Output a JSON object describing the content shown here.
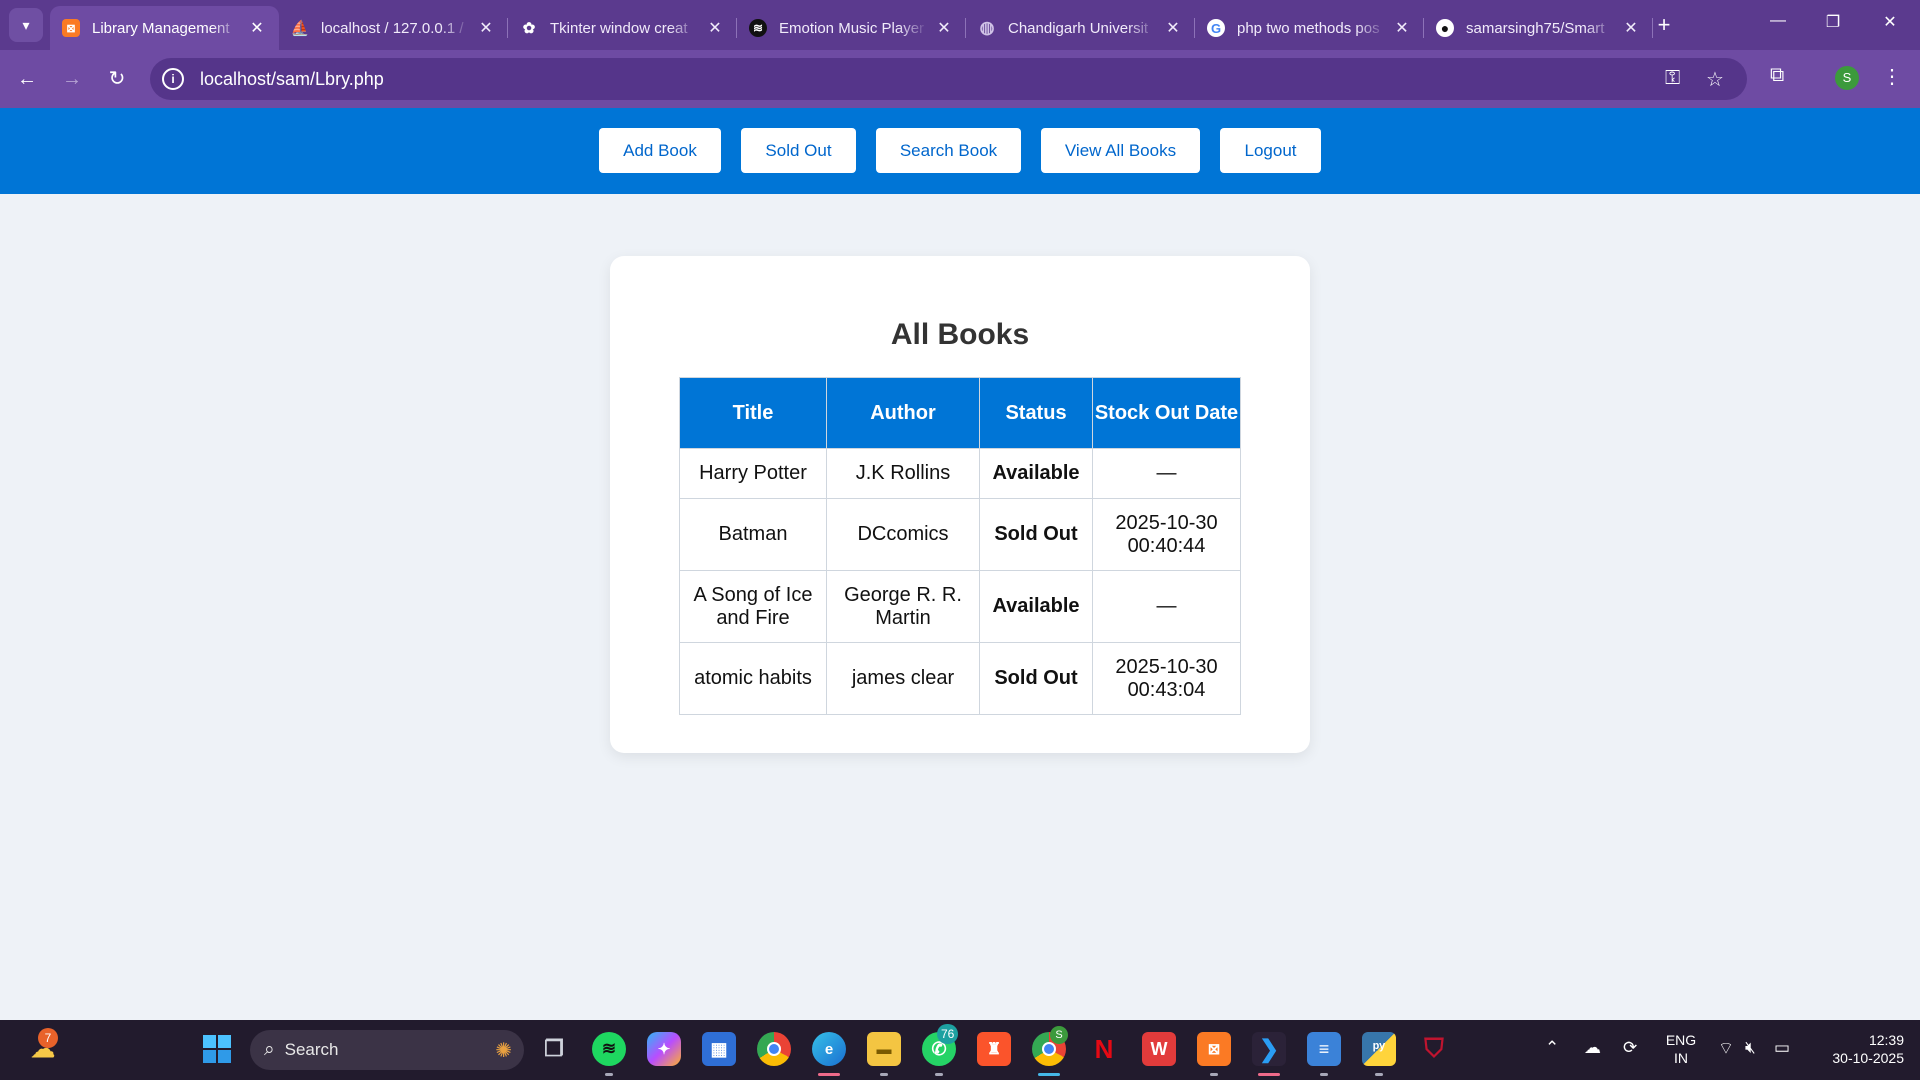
{
  "browser": {
    "tabs": [
      {
        "title": "Library Management",
        "icon": "xampp-icon",
        "color": "#fb7a24",
        "glyph": "⊠"
      },
      {
        "title": "localhost / 127.0.0.1 / ",
        "icon": "phpmyadmin-icon",
        "color": "#f89c0e",
        "glyph": "⛵"
      },
      {
        "title": "Tkinter window creat",
        "icon": "chatgpt-icon",
        "color": "#5b3a8e",
        "glyph": "✿"
      },
      {
        "title": "Emotion Music Player",
        "icon": "spotify-icon",
        "color": "#111111",
        "glyph": "≋"
      },
      {
        "title": "Chandigarh Universit",
        "icon": "globe-icon",
        "color": "#8d72b8",
        "glyph": "◍"
      },
      {
        "title": "php two methods pos",
        "icon": "google-icon",
        "color": "#ffffff",
        "glyph": "G"
      },
      {
        "title": "samarsingh75/Smart",
        "icon": "github-icon",
        "color": "#111111",
        "glyph": "●"
      }
    ],
    "url": "localhost/sam/Lbry.php",
    "profile_initial": "S"
  },
  "nav": {
    "buttons": [
      "Add Book",
      "Sold Out",
      "Search Book",
      "View All Books",
      "Logout"
    ]
  },
  "main": {
    "title": "All Books",
    "table": {
      "headers": [
        "Title",
        "Author",
        "Status",
        "Stock Out Date"
      ],
      "rows": [
        {
          "title": "Harry Potter",
          "author": "J.K Rollins",
          "status": "Available",
          "date": "—"
        },
        {
          "title": "Batman",
          "author": "DCcomics",
          "status": "Sold Out",
          "date": "2025-10-30 00:40:44"
        },
        {
          "title": "A Song of Ice and Fire",
          "author": "George R. R. Martin",
          "status": "Available",
          "date": "—"
        },
        {
          "title": "atomic habits",
          "author": "james clear",
          "status": "Sold Out",
          "date": "2025-10-30 00:43:04"
        }
      ]
    }
  },
  "taskbar": {
    "search_label": "Search",
    "weather_badge": "7",
    "whatsapp_badge": "76",
    "chrome_badge": "S",
    "language": "ENG",
    "region": "IN",
    "time": "12:39",
    "date": "30-10-2025"
  },
  "colors": {
    "accent": "#0075d6",
    "available": "#198a19",
    "sold_out": "#e61e1e",
    "chrome": "#6e4ba3"
  }
}
